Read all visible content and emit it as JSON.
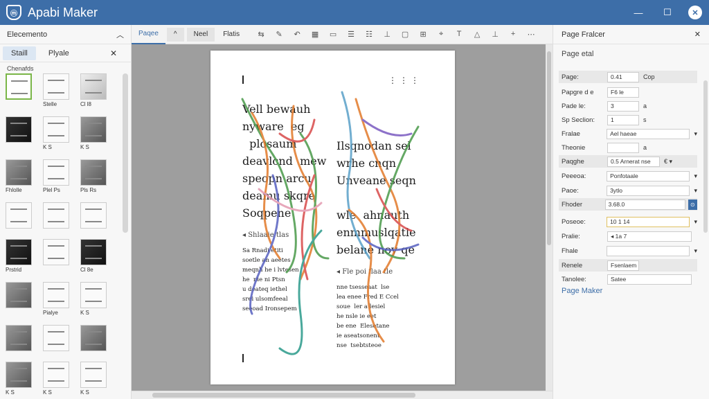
{
  "app": {
    "logo": "ⓜ",
    "title": "Apabi Maker",
    "controls": {
      "minimize": "—",
      "maximize": "☐",
      "close": "✕"
    }
  },
  "left_panel": {
    "title": "Elecemento",
    "collapse_icon": "︿",
    "tabs": [
      "Staill",
      "Plyale"
    ],
    "close": "✕",
    "section_label": "Chenafds",
    "thumbs": [
      {
        "caption": "",
        "style": "sel"
      },
      {
        "caption": "Stelle",
        "style": "light"
      },
      {
        "caption": "Cl l8",
        "style": ""
      },
      {
        "caption": "",
        "style": "dark"
      },
      {
        "caption": "K  S",
        "style": "light"
      },
      {
        "caption": "K  S",
        "style": "mid"
      },
      {
        "caption": "Fhlolle",
        "style": "mid"
      },
      {
        "caption": "Plel  Ps",
        "style": "light"
      },
      {
        "caption": "Pls  Rs",
        "style": "mid"
      },
      {
        "caption": "",
        "style": "light"
      },
      {
        "caption": "",
        "style": "light"
      },
      {
        "caption": "",
        "style": "light"
      },
      {
        "caption": "Prstrid",
        "style": "dark"
      },
      {
        "caption": "",
        "style": "light"
      },
      {
        "caption": "Cl 8e",
        "style": "dark"
      },
      {
        "caption": "",
        "style": "mid"
      },
      {
        "caption": "Pialye",
        "style": "light"
      },
      {
        "caption": "K  S",
        "style": "light"
      },
      {
        "caption": "",
        "style": "mid"
      },
      {
        "caption": "",
        "style": "light"
      },
      {
        "caption": "",
        "style": "mid"
      },
      {
        "caption": "K  S",
        "style": "mid"
      },
      {
        "caption": "K  S",
        "style": "light"
      },
      {
        "caption": "K  S",
        "style": "light"
      }
    ]
  },
  "toolbar": {
    "tabs": [
      "Paqee",
      "^",
      "Neel",
      "Flatis"
    ],
    "icons": [
      "⇆",
      "✎",
      "↶",
      "▦",
      "▭",
      "☰",
      "☷",
      "⊥",
      "▢",
      "⊞",
      "⌖",
      "T",
      "△",
      "⊥",
      "+",
      "⋯"
    ]
  },
  "page": {
    "dots": "⋮⋮⋮",
    "left_head": "Vell bewauh\nnyware  eg\n  plosaum\ndeavlcnd  mew\nspeopn arcu\ndeamu skqre\nSoqpene",
    "right_head": "Ilsqnodan sel\nwrhe cnqn\nUnveane seqn\n\nwle  ahnauth\nenmmuslqatle\nbelane noy qe",
    "left_sub": "◂  Shlaaie tlas",
    "right_sub": "◂  Fle poi flaa tle",
    "left_body": "Sa Rnadi etiti\nsoetle an aeetes\nmeqnh he i lvtesen\nhe  nie ni Ptsn\nu deateq iethel\nsrei ulsomfeeal\nseeoad Ironsepem",
    "right_body": "nne tsesseaat  lse\nlea enee Fred E Ccel\nsoue  ler a lesiel\nhe nsle ie eet\nbe ene  Elesetane\nie aseatsonent\nnse  tsebtsteoe"
  },
  "right_panel": {
    "title": "Page Fralcer",
    "close": "✕",
    "subtitle": "Page etal",
    "rows": [
      {
        "label": "Page:",
        "value": "0.41",
        "unit": "Cop",
        "shade": true
      },
      {
        "label": "Papgre d e",
        "value": "F6 le",
        "unit": "",
        "shade": false
      },
      {
        "label": "Pade le:",
        "value": "3",
        "unit": "a",
        "shade": false
      },
      {
        "label": "Sp Seclion:",
        "value": "1",
        "unit": "s",
        "shade": false
      },
      {
        "label": "Fralae",
        "value": "Ael haeae",
        "unit": "▾",
        "shade": false
      },
      {
        "label": "Theonie",
        "value": "",
        "unit": "a",
        "shade": false
      },
      {
        "label": "Paqghe",
        "value": "0.5 Arnerat nse",
        "unit": "€ ▾",
        "shade": true
      },
      {
        "label": "Peeeoa:",
        "value": "Ponfotaale",
        "unit": "▾",
        "shade": false
      },
      {
        "label": "Paoe:",
        "value": "3ytlo",
        "unit": "▾",
        "shade": false
      },
      {
        "label": "Fhoder",
        "value": "3.68.0",
        "unit": "⊙",
        "shade": true
      },
      {
        "label": "Poseoe:",
        "value": "10 1        14",
        "unit": "▾",
        "shade": false
      },
      {
        "label": "Pralie:",
        "value": "◂        1a        7",
        "unit": "",
        "shade": false
      },
      {
        "label": "Fhale",
        "value": "",
        "unit": "▾",
        "shade": false
      },
      {
        "label": "Renele",
        "value": "Fsenlaem",
        "unit": "",
        "shade": true
      },
      {
        "label": "Tanolee:",
        "value": "Satee",
        "unit": "",
        "shade": false
      }
    ],
    "link": "Page Maker"
  }
}
